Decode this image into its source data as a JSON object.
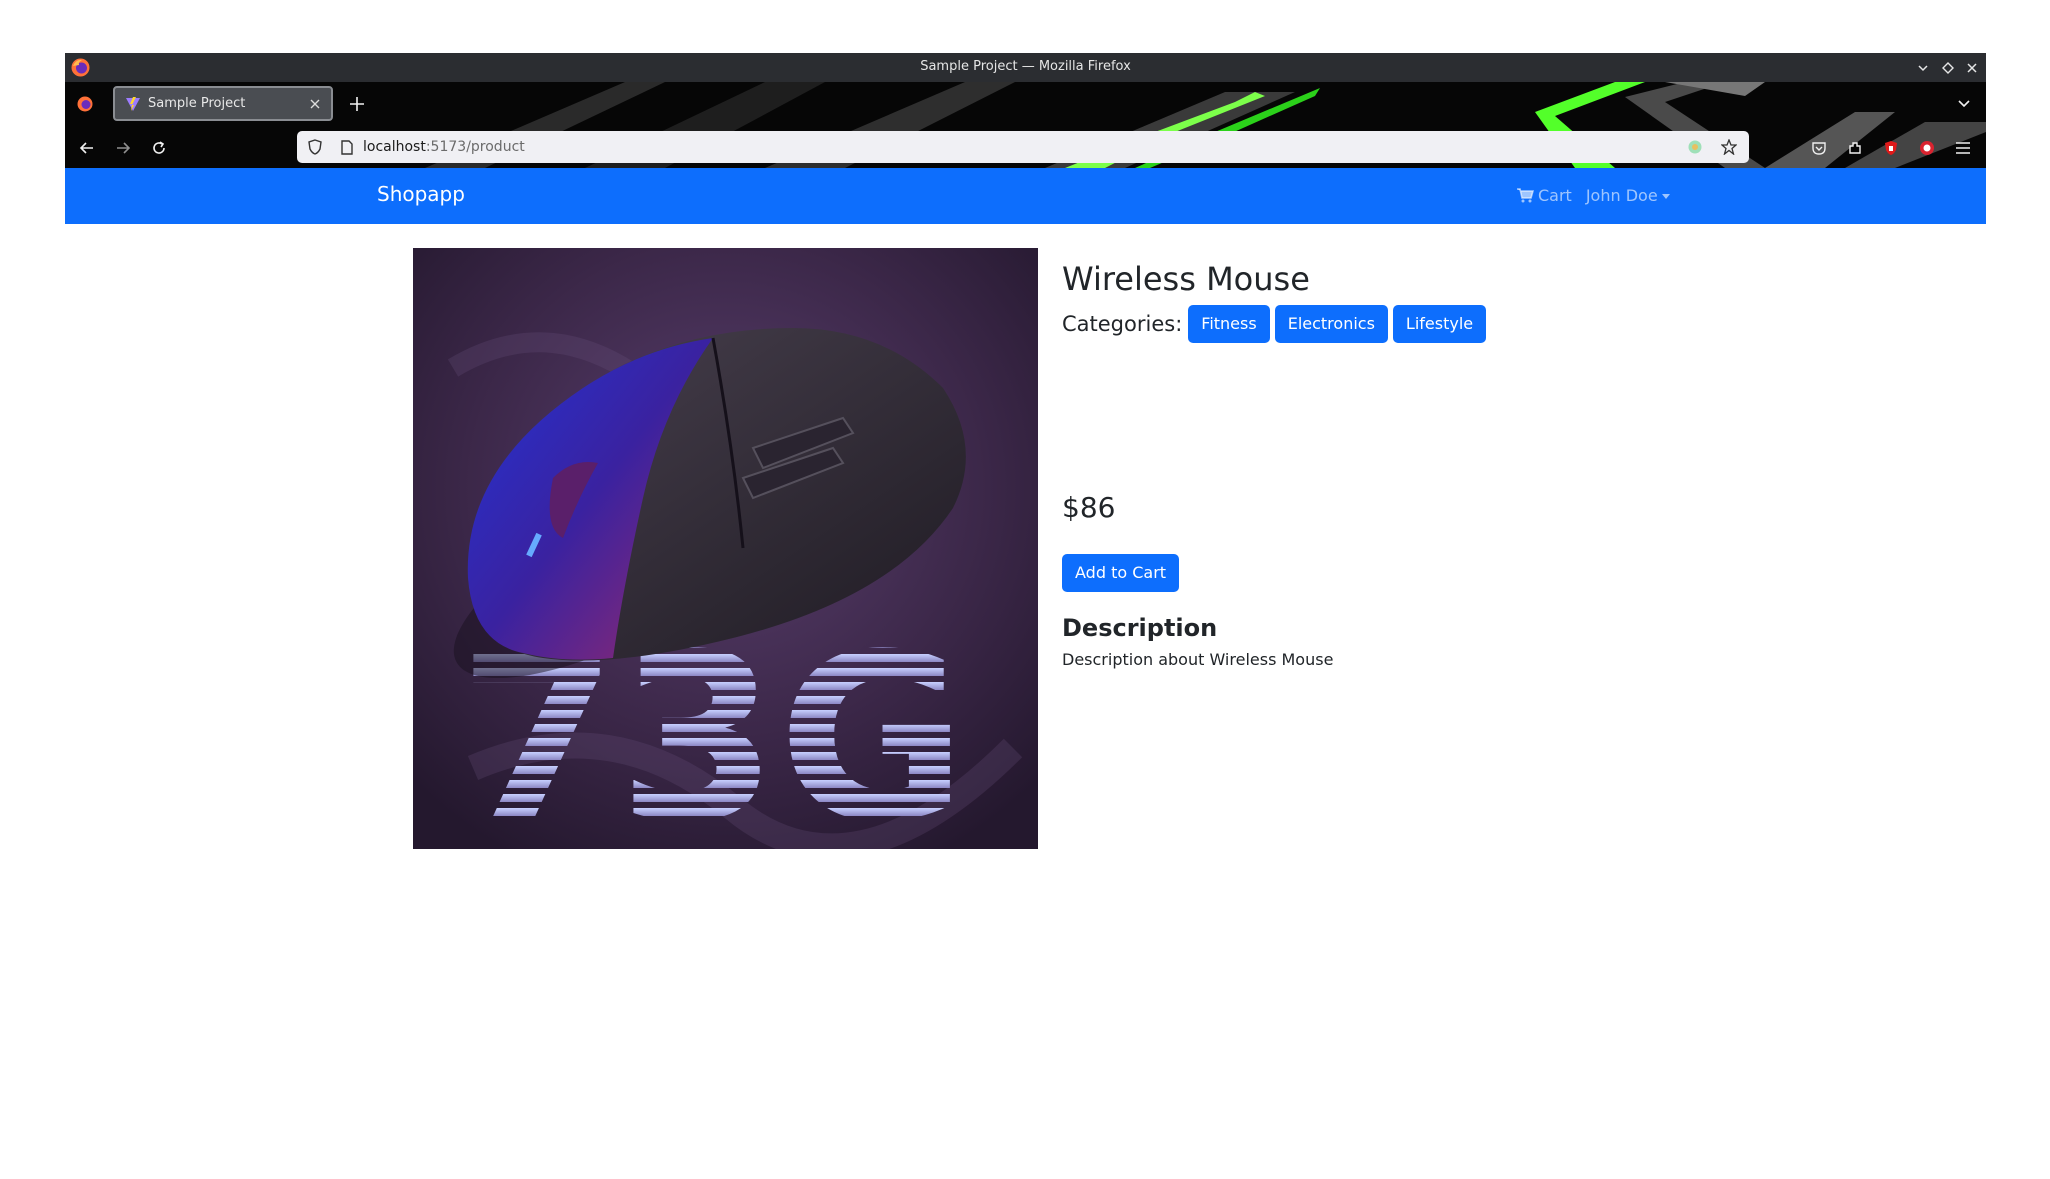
{
  "window": {
    "title": "Sample Project — Mozilla Firefox"
  },
  "browser": {
    "tab_title": "Sample Project",
    "url_host": "localhost",
    "url_path": ":5173/product"
  },
  "app": {
    "brand": "Shopapp",
    "cart_label": "Cart",
    "user_name": "John Doe"
  },
  "product": {
    "title": "Wireless Mouse",
    "categories_label": "Categories:",
    "categories": [
      "Fitness",
      "Electronics",
      "Lifestyle"
    ],
    "price": "$86",
    "add_to_cart": "Add to Cart",
    "description_heading": "Description",
    "description": "Description about Wireless Mouse",
    "image_text": "73G"
  },
  "colors": {
    "primary": "#0d6efd",
    "titlebar": "#2b2d31"
  }
}
